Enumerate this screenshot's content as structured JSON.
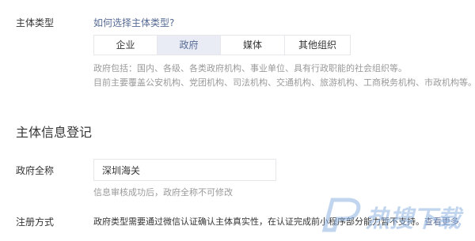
{
  "subject_type": {
    "label": "主体类型",
    "help_link": "如何选择主体类型?",
    "options": [
      "企业",
      "政府",
      "媒体",
      "其他组织"
    ],
    "selected": "政府",
    "note_line1": "政府包括：国内、各级、各类政府机构、事业单位、具有行政职能的社会组织等。",
    "note_line2": "目前主要覆盖公安机构、党团机构、司法机构、交通机构、旅游机构、工商税务机构、市政机构等。"
  },
  "subject_info": {
    "title": "主体信息登记",
    "gov_name_label": "政府全称",
    "gov_name_value": "深圳海关",
    "gov_name_hint": "信息审核成功后，政府全称不可修改"
  },
  "registration": {
    "label": "注册方式",
    "text": "政府类型需要通过微信认证确认主体真实性，在认证完成前小程序部分能力暂不支持。",
    "more_link": "查看更多"
  },
  "watermark": {
    "text": "热搜下载",
    "color": "#8fb4e3"
  },
  "colors": {
    "link": "#576b95",
    "selected_bg": "#e9ecf4",
    "border": "#e7e7eb",
    "muted": "#9a9a9a"
  }
}
